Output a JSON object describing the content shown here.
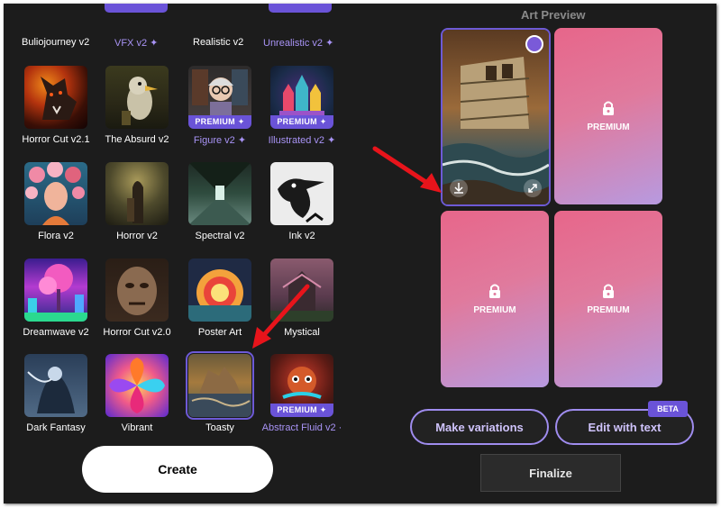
{
  "top_row": [
    {
      "label": "Buliojourney v2",
      "premium": false
    },
    {
      "label": "VFX v2 ✦",
      "premium": true
    },
    {
      "label": "Realistic v2",
      "premium": false
    },
    {
      "label": "Unrealistic v2 ✦",
      "premium": true
    }
  ],
  "styles": [
    {
      "label": "Horror Cut v2.1",
      "premium": false
    },
    {
      "label": "The Absurd v2",
      "premium": false
    },
    {
      "label": "Figure v2 ✦",
      "premium": true
    },
    {
      "label": "Illustrated v2 ✦",
      "premium": true
    },
    {
      "label": "Flora v2",
      "premium": false
    },
    {
      "label": "Horror v2",
      "premium": false
    },
    {
      "label": "Spectral v2",
      "premium": false
    },
    {
      "label": "Ink v2",
      "premium": false
    },
    {
      "label": "Dreamwave v2",
      "premium": false
    },
    {
      "label": "Horror Cut v2.0",
      "premium": false
    },
    {
      "label": "Poster Art",
      "premium": false
    },
    {
      "label": "Mystical",
      "premium": false
    },
    {
      "label": "Dark Fantasy",
      "premium": false
    },
    {
      "label": "Vibrant",
      "premium": false
    },
    {
      "label": "Toasty",
      "premium": false,
      "selected": true
    },
    {
      "label": "Abstract Fluid v2 ·",
      "premium": true
    }
  ],
  "premium_badge": "PREMIUM ✦",
  "create_label": "Create",
  "art_preview": {
    "title": "Art Preview",
    "premium_label": "PREMIUM"
  },
  "actions": {
    "make_variations": "Make variations",
    "edit_with_text": "Edit with text",
    "beta": "BETA",
    "finalize": "Finalize"
  },
  "colors": {
    "accent": "#6a53d8",
    "background": "#1c1c1c",
    "arrow": "#e8141b"
  }
}
